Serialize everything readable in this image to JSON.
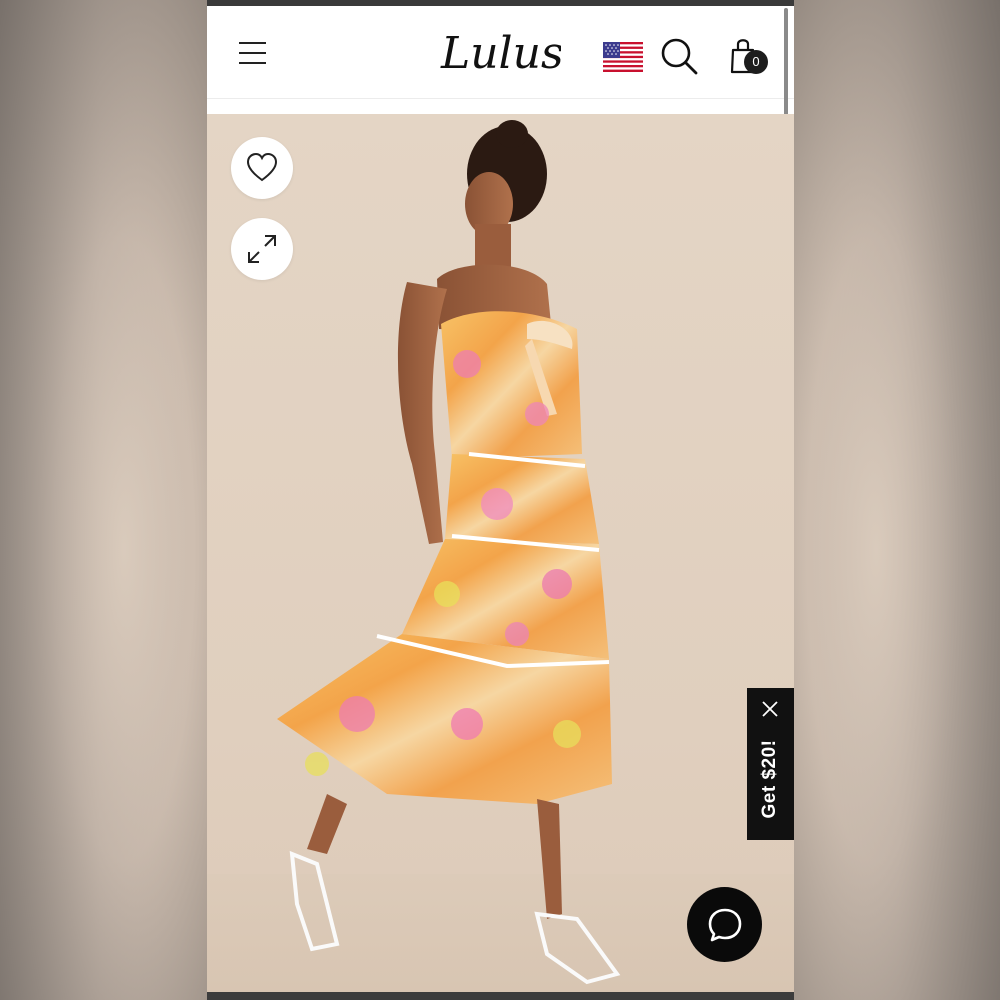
{
  "header": {
    "brand": "Lulus",
    "cart_count": "0"
  },
  "promo": {
    "label": "Get $20!"
  },
  "icons": {
    "menu": "hamburger-menu-icon",
    "flag": "us-flag-icon",
    "search": "search-icon",
    "bag": "shopping-bag-icon",
    "favorite": "heart-icon",
    "expand": "expand-icon",
    "close": "close-icon",
    "chat": "chat-bubble-icon"
  },
  "colors": {
    "header_bg": "#ffffff",
    "promo_bg": "#111111",
    "chat_bg": "#0a0a0a",
    "image_bg": "#e2d2c1"
  }
}
